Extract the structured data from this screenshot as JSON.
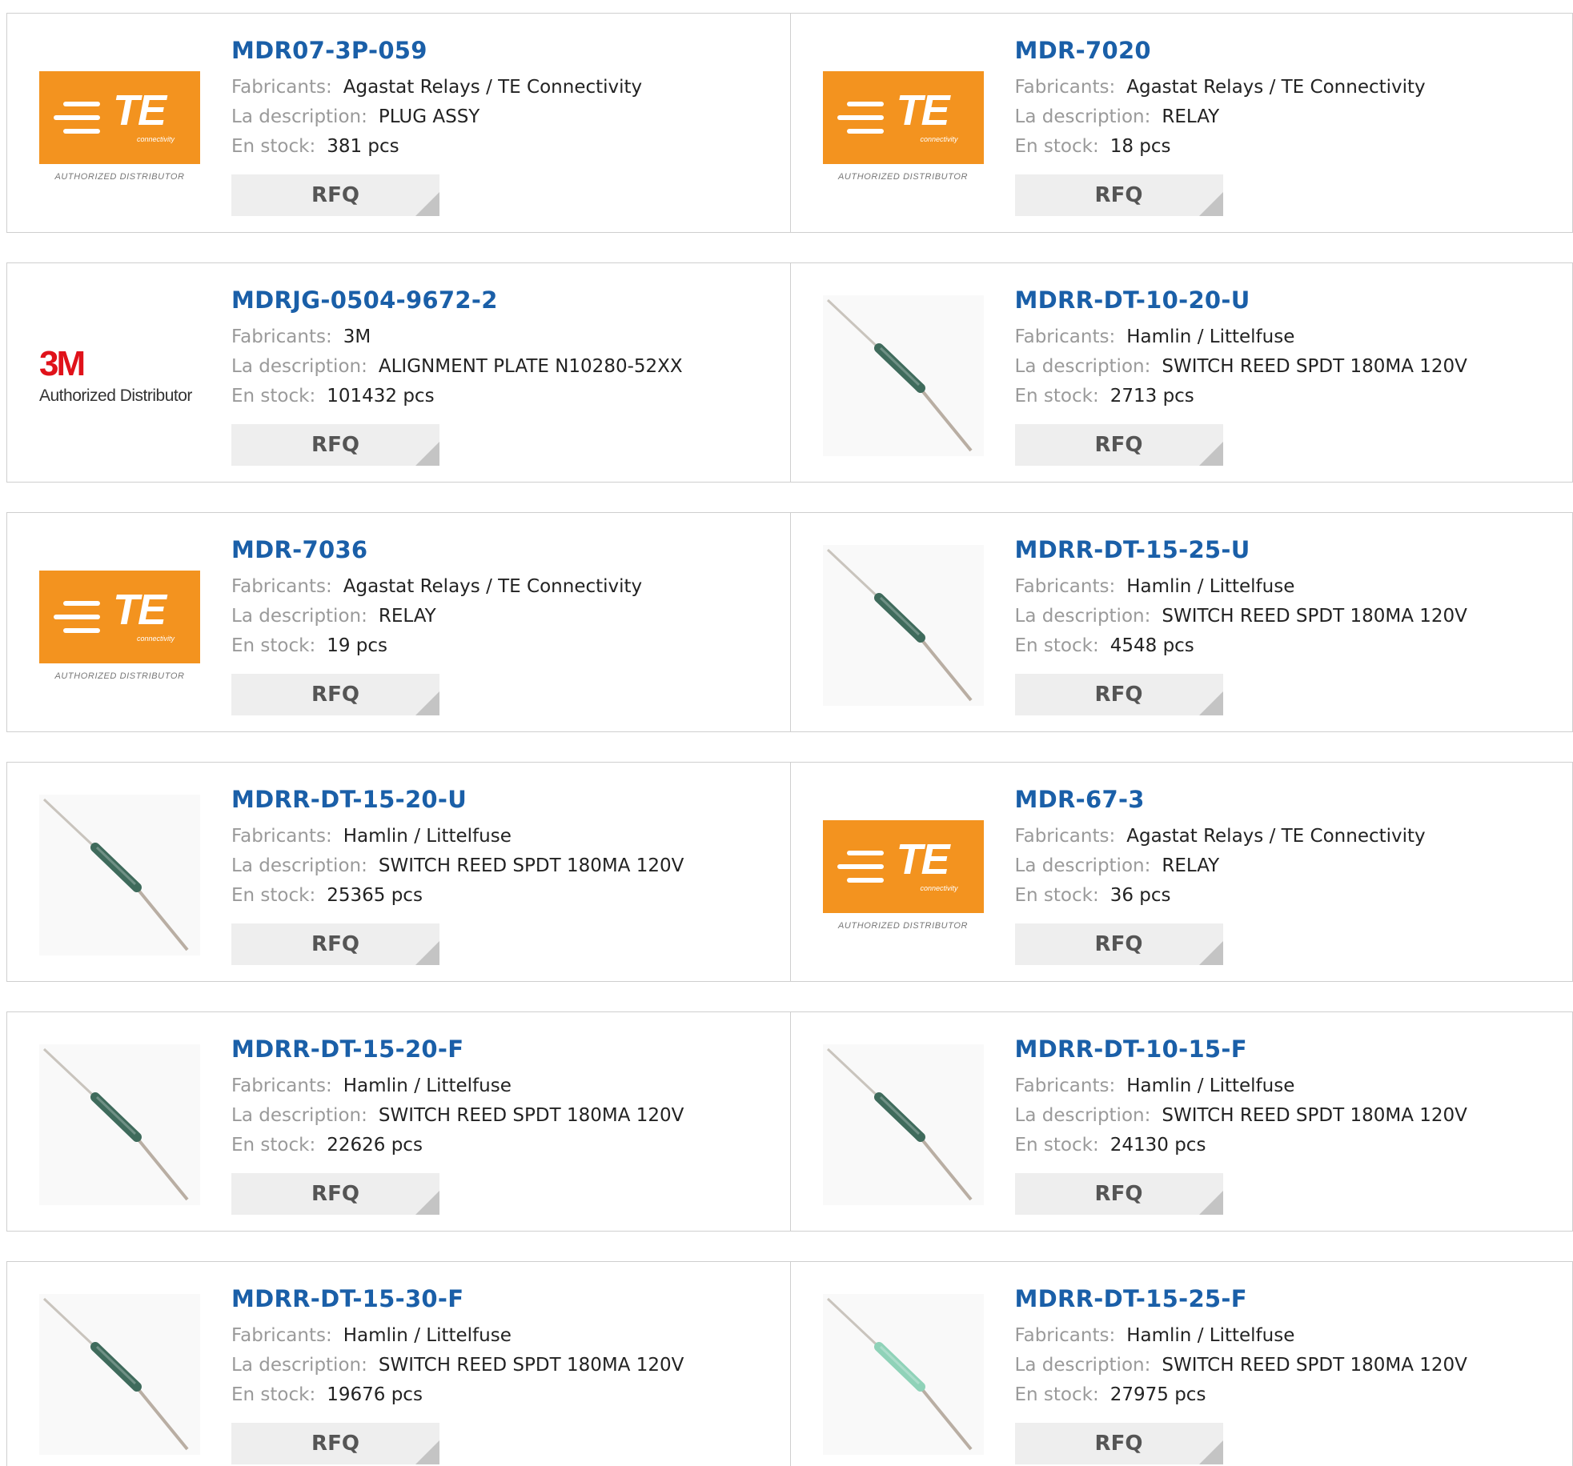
{
  "labels": {
    "manufacturer": "Fabricants:",
    "description": "La description:",
    "stock": "En stock:",
    "rfq": "RFQ"
  },
  "logos": {
    "te": {
      "brand": "TE",
      "sub": "connectivity",
      "tag": "AUTHORIZED DISTRIBUTOR",
      "color": "#f3931f"
    },
    "m3": {
      "brand": "3M",
      "tag": "Authorized Distributor",
      "color": "#e0121a"
    }
  },
  "colors": {
    "part_link": "#1a5fa8",
    "label": "#9a9a9a",
    "rfq_bg": "#eeeeee"
  },
  "products": [
    {
      "part": "MDR07-3P-059",
      "manufacturer": "Agastat Relays / TE Connectivity",
      "description": "PLUG ASSY",
      "stock": "381 pcs",
      "image": "te-logo"
    },
    {
      "part": "MDR-7020",
      "manufacturer": "Agastat Relays / TE Connectivity",
      "description": "RELAY",
      "stock": "18 pcs",
      "image": "te-logo"
    },
    {
      "part": "MDRJG-0504-9672-2",
      "manufacturer": "3M",
      "description": "ALIGNMENT PLATE N10280-52XX",
      "stock": "101432 pcs",
      "image": "3m-logo"
    },
    {
      "part": "MDRR-DT-10-20-U",
      "manufacturer": "Hamlin / Littelfuse",
      "description": "SWITCH REED SPDT 180MA 120V",
      "stock": "2713 pcs",
      "image": "reed-straight"
    },
    {
      "part": "MDR-7036",
      "manufacturer": "Agastat Relays / TE Connectivity",
      "description": "RELAY",
      "stock": "19 pcs",
      "image": "te-logo"
    },
    {
      "part": "MDRR-DT-15-25-U",
      "manufacturer": "Hamlin / Littelfuse",
      "description": "SWITCH REED SPDT 180MA 120V",
      "stock": "4548 pcs",
      "image": "reed-straight"
    },
    {
      "part": "MDRR-DT-15-20-U",
      "manufacturer": "Hamlin / Littelfuse",
      "description": "SWITCH REED SPDT 180MA 120V",
      "stock": "25365 pcs",
      "image": "reed-straight"
    },
    {
      "part": "MDR-67-3",
      "manufacturer": "Agastat Relays / TE Connectivity",
      "description": "RELAY",
      "stock": "36 pcs",
      "image": "te-logo"
    },
    {
      "part": "MDRR-DT-15-20-F",
      "manufacturer": "Hamlin / Littelfuse",
      "description": "SWITCH REED SPDT 180MA 120V",
      "stock": "22626 pcs",
      "image": "reed-forked"
    },
    {
      "part": "MDRR-DT-10-15-F",
      "manufacturer": "Hamlin / Littelfuse",
      "description": "SWITCH REED SPDT 180MA 120V",
      "stock": "24130 pcs",
      "image": "reed-forked"
    },
    {
      "part": "MDRR-DT-15-30-F",
      "manufacturer": "Hamlin / Littelfuse",
      "description": "SWITCH REED SPDT 180MA 120V",
      "stock": "19676 pcs",
      "image": "reed-forked"
    },
    {
      "part": "MDRR-DT-15-25-F",
      "manufacturer": "Hamlin / Littelfuse",
      "description": "SWITCH REED SPDT 180MA 120V",
      "stock": "27975 pcs",
      "image": "reed-forked-light"
    }
  ]
}
